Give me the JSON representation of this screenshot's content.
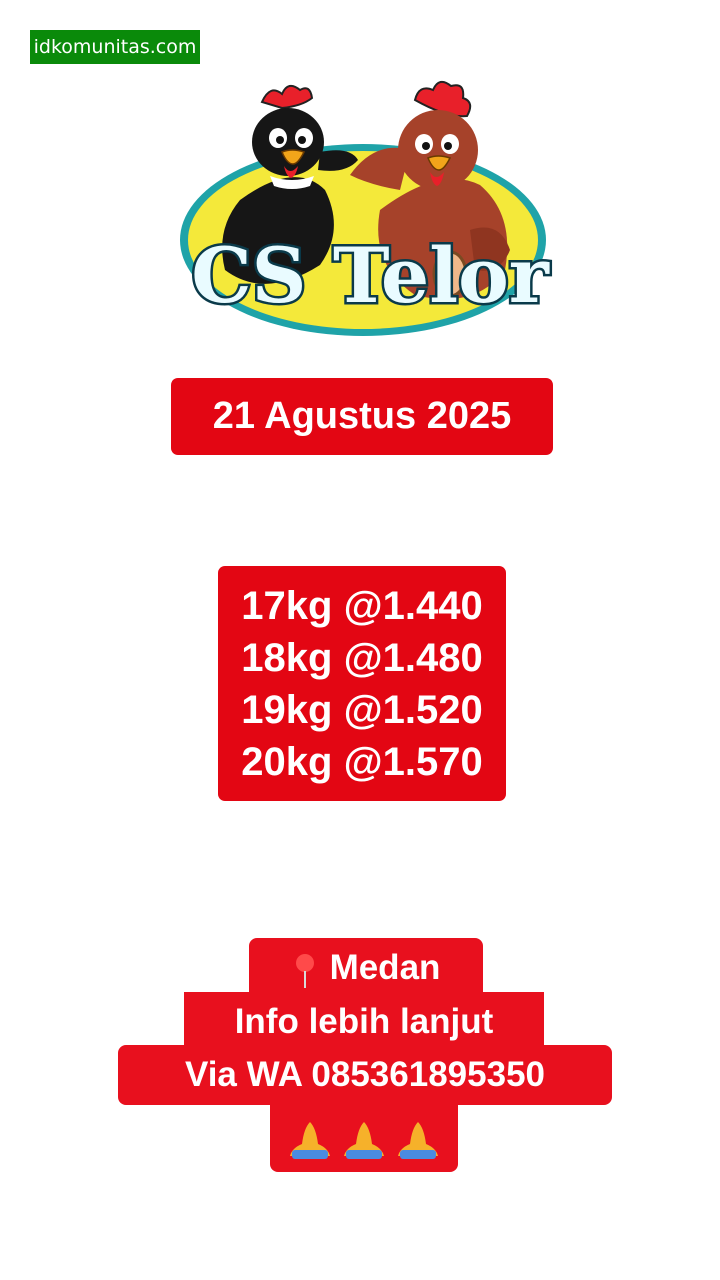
{
  "watermark": "idkomunitas.com",
  "logo": {
    "brand": "CS Telor"
  },
  "date": "21 Agustus 2025",
  "prices": [
    {
      "weight": "17kg",
      "price": "1.440",
      "text": "17kg @1.440"
    },
    {
      "weight": "18kg",
      "price": "1.480",
      "text": "18kg @1.480"
    },
    {
      "weight": "19kg",
      "price": "1.520",
      "text": "19kg @1.520"
    },
    {
      "weight": "20kg",
      "price": "1.570",
      "text": "20kg @1.570"
    }
  ],
  "info": {
    "location": "Medan",
    "line2": "Info lebih lanjut",
    "line3": "Via WA 085361895350",
    "icons": [
      "pin-icon",
      "folded-hands-icon",
      "folded-hands-icon",
      "folded-hands-icon"
    ]
  },
  "colors": {
    "red_box": "#e30613",
    "watermark_green": "#0a8a0a",
    "logo_yellow": "#f4e93a",
    "logo_teal": "#1fa3a8"
  }
}
